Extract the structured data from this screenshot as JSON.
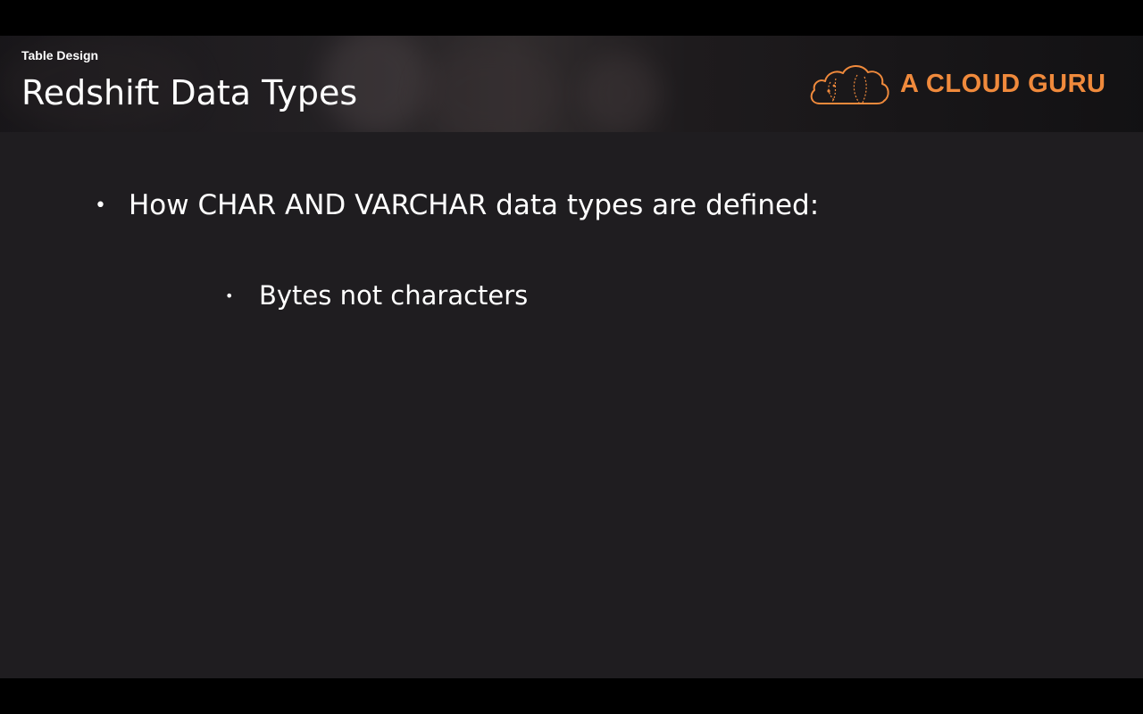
{
  "slide": {
    "section_label": "Table Design",
    "title": "Redshift Data Types",
    "brand": {
      "logo_icon": "cloud-icon",
      "name": "A CLOUD GURU",
      "color": "#f08a3c"
    },
    "bullets": [
      {
        "level": 1,
        "text": "How CHAR AND VARCHAR data types are defined:",
        "children": [
          {
            "level": 2,
            "text": "Bytes not characters"
          }
        ]
      }
    ]
  },
  "colors": {
    "letterbox": "#000000",
    "slide_background": "#1f1d20",
    "text": "#ffffff",
    "accent": "#f08a3c"
  }
}
